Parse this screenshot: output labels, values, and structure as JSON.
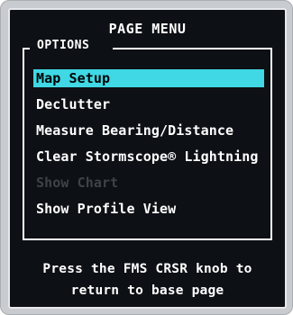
{
  "menu": {
    "title": "PAGE MENU",
    "section_label": "OPTIONS",
    "items": [
      {
        "label": "Map Setup",
        "state": "selected"
      },
      {
        "label": "Declutter",
        "state": "enabled"
      },
      {
        "label": "Measure Bearing/Distance",
        "state": "enabled"
      },
      {
        "label": "Clear Stormscope® Lightning",
        "state": "enabled"
      },
      {
        "label": "Show Chart",
        "state": "disabled"
      },
      {
        "label": "Show Profile View",
        "state": "enabled"
      }
    ],
    "hint_line1": "Press the FMS CRSR knob to",
    "hint_line2": "return to base page"
  },
  "colors": {
    "screen_background": "#0d1014",
    "selection_highlight": "#3fd8e4",
    "text": "#ffffff",
    "disabled_text": "#3e4349"
  }
}
